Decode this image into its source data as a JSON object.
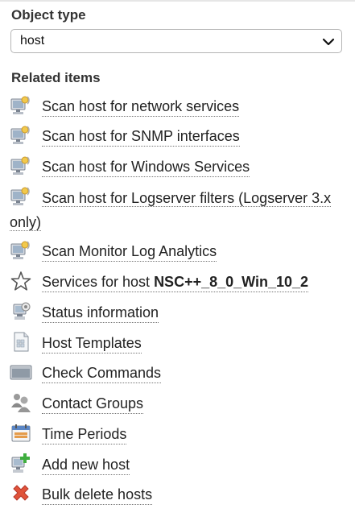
{
  "object_type": {
    "title": "Object type",
    "selected": "host"
  },
  "related": {
    "title": "Related items",
    "items": [
      {
        "label": "Scan host for network services",
        "icon": "network-scan-icon"
      },
      {
        "label": "Scan host for SNMP interfaces",
        "icon": "network-scan-icon"
      },
      {
        "label": "Scan host for Windows Services",
        "icon": "network-scan-icon"
      },
      {
        "label": "Scan host for Logserver filters (Logserver 3.x only)",
        "icon": "network-scan-icon"
      },
      {
        "label": "Scan Monitor Log Analytics",
        "icon": "network-scan-icon"
      },
      {
        "label_prefix": "Services for host ",
        "label_bold": "NSC++_8_0_Win_10_2",
        "icon": "star-icon"
      },
      {
        "label": "Status information",
        "icon": "status-info-icon"
      },
      {
        "label": "Host Templates",
        "icon": "document-icon"
      },
      {
        "label": "Check Commands",
        "icon": "terminal-icon"
      },
      {
        "label": "Contact Groups",
        "icon": "contact-group-icon"
      },
      {
        "label": "Time Periods",
        "icon": "calendar-icon"
      },
      {
        "label": "Add new host",
        "icon": "add-host-icon"
      },
      {
        "label": "Bulk delete hosts",
        "icon": "delete-icon"
      }
    ]
  }
}
